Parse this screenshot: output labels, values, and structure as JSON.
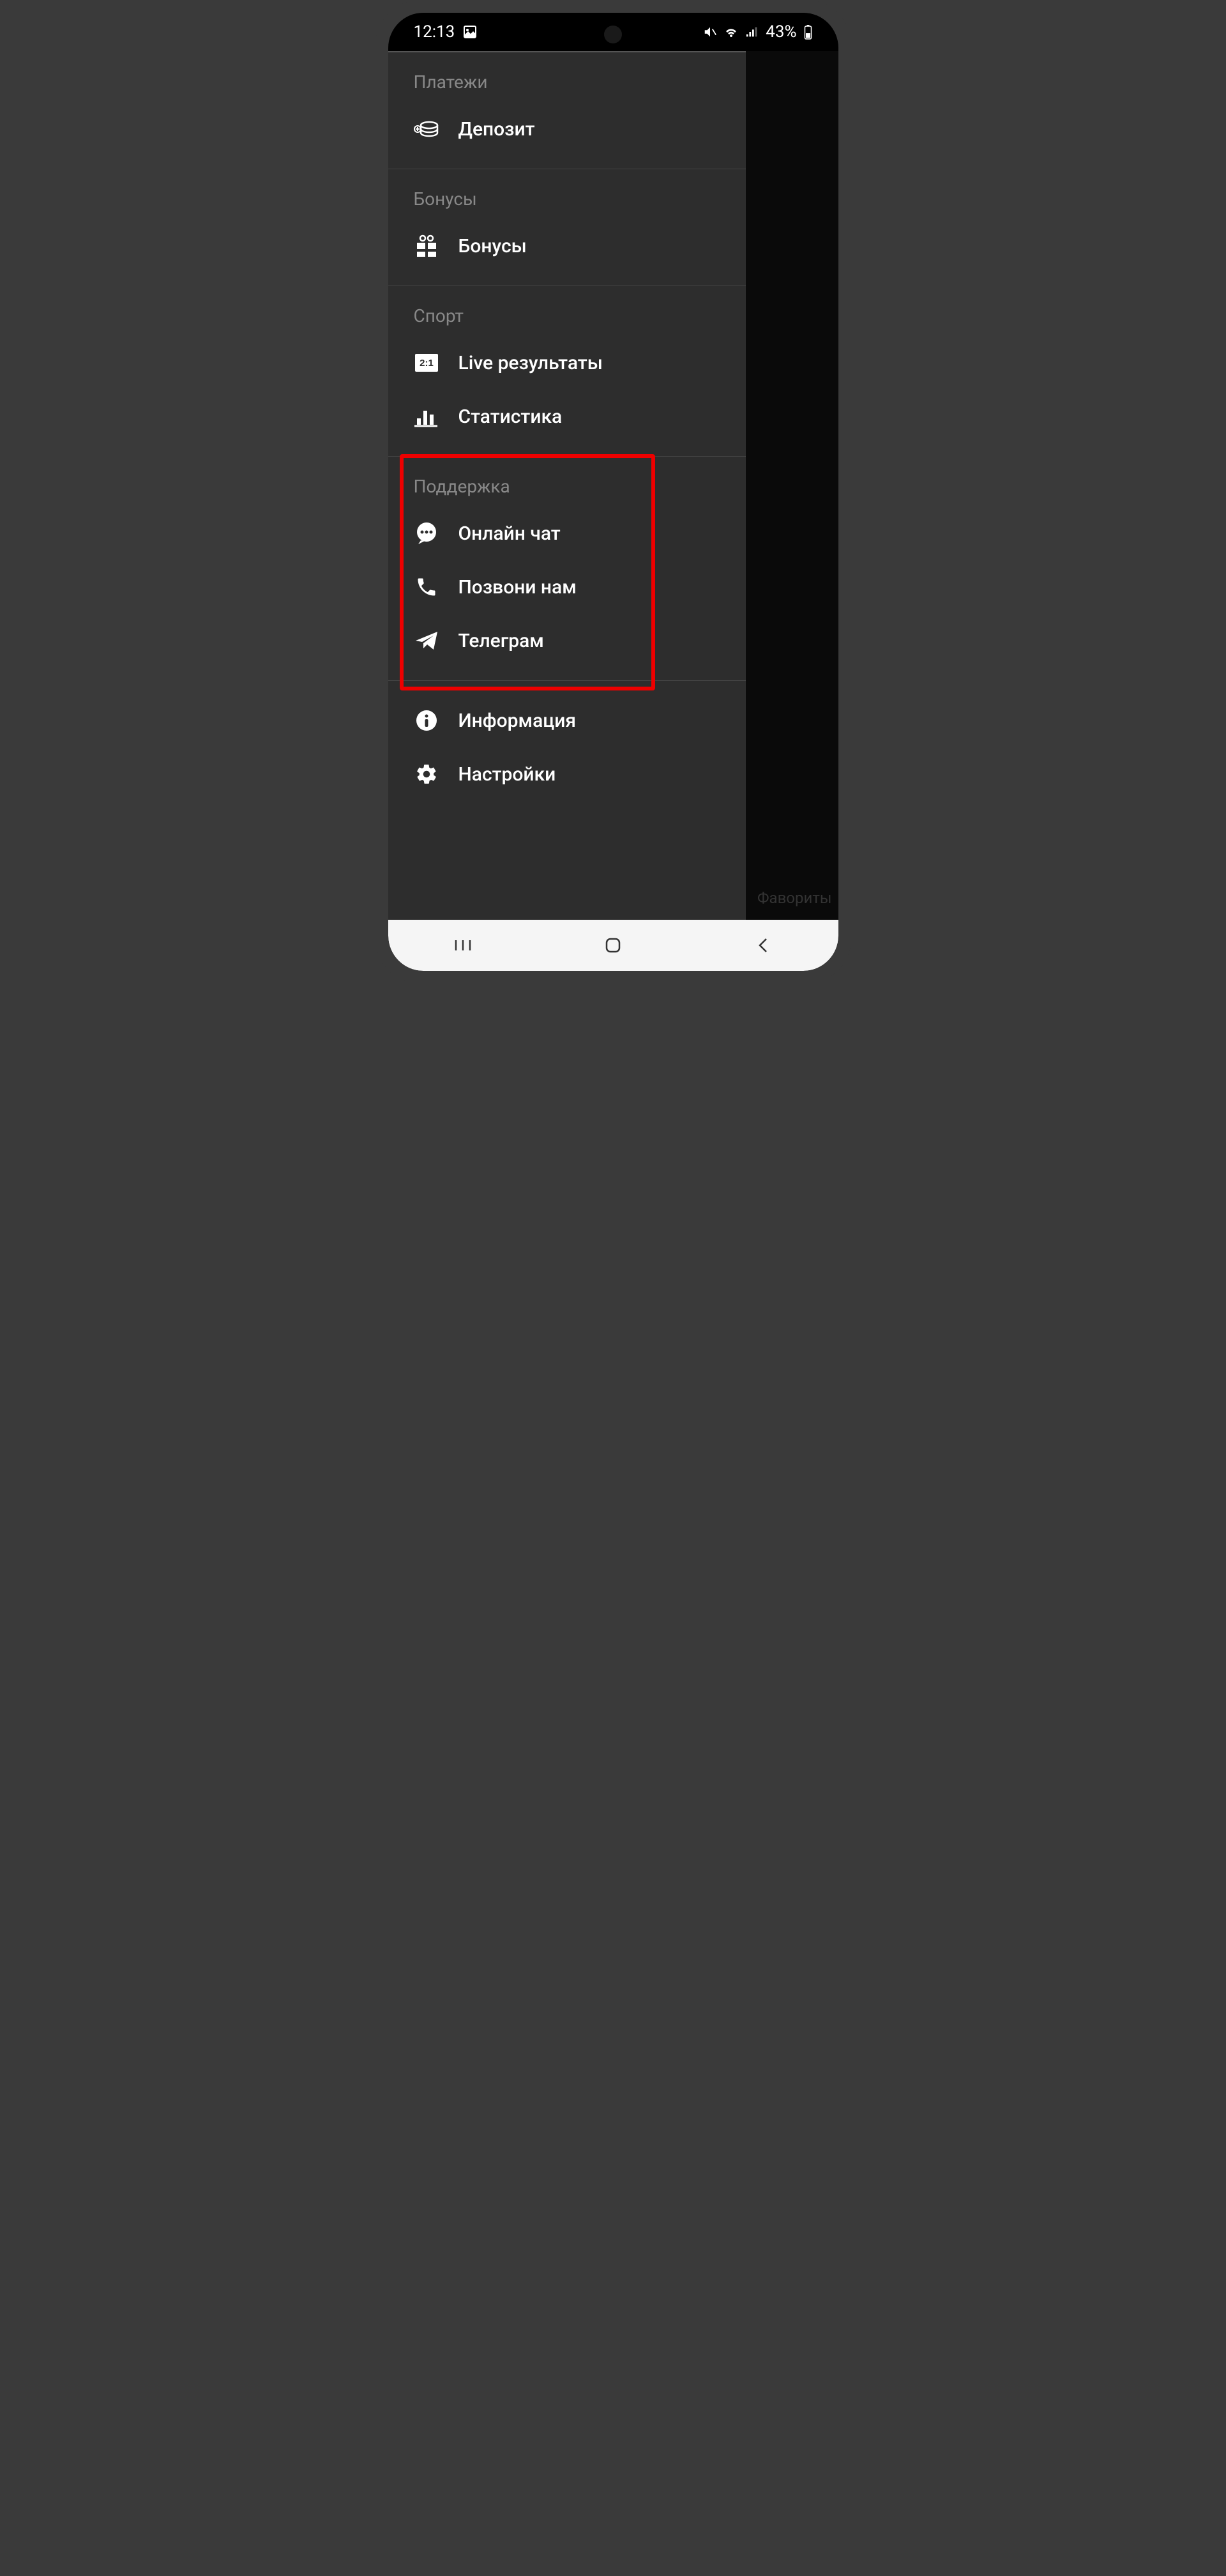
{
  "status": {
    "time": "12:13",
    "battery": "43%"
  },
  "menu": {
    "sections": [
      {
        "title": "Платежи",
        "items": [
          {
            "icon": "coins",
            "label": "Депозит"
          }
        ]
      },
      {
        "title": "Бонусы",
        "items": [
          {
            "icon": "gift",
            "label": "Бонусы"
          }
        ]
      },
      {
        "title": "Спорт",
        "items": [
          {
            "icon": "score",
            "label": "Live результаты"
          },
          {
            "icon": "bars",
            "label": "Статистика"
          }
        ]
      },
      {
        "title": "Поддержка",
        "items": [
          {
            "icon": "chat",
            "label": "Онлайн чат"
          },
          {
            "icon": "phone",
            "label": "Позвони нам"
          },
          {
            "icon": "telegram",
            "label": "Телеграм"
          }
        ]
      },
      {
        "title": "",
        "items": [
          {
            "icon": "info",
            "label": "Информация"
          },
          {
            "icon": "gear",
            "label": "Настройки"
          }
        ]
      }
    ]
  },
  "right_panel": {
    "fav_label": "Фавориты"
  }
}
